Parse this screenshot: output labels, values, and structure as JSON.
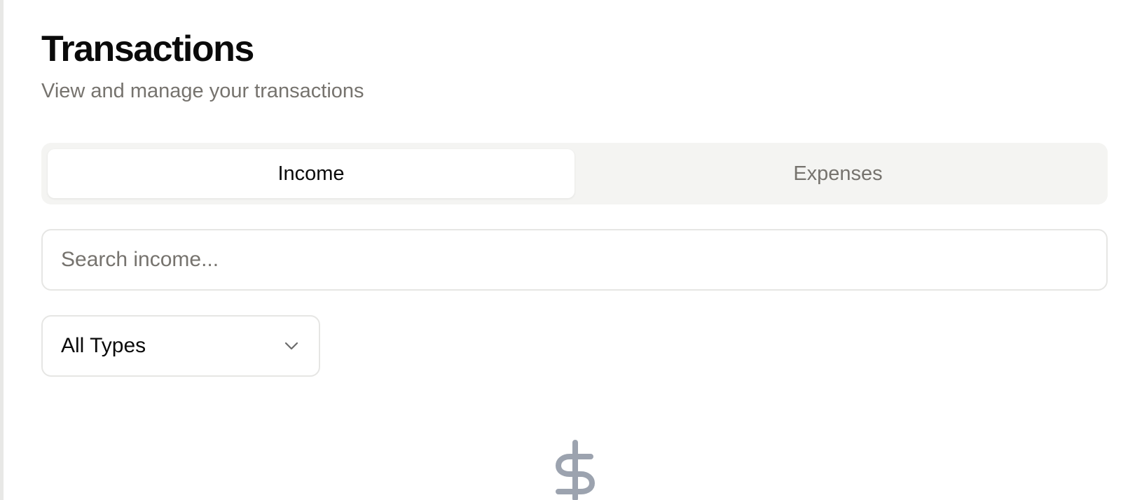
{
  "header": {
    "title": "Transactions",
    "subtitle": "View and manage your transactions"
  },
  "tabs": [
    {
      "label": "Income",
      "active": true
    },
    {
      "label": "Expenses",
      "active": false
    }
  ],
  "search": {
    "placeholder": "Search income...",
    "value": ""
  },
  "filter": {
    "selected": "All Types",
    "icon": "chevron-down-icon"
  },
  "empty_state": {
    "icon": "dollar-sign-icon",
    "icon_color": "#9ca3af"
  },
  "colors": {
    "text_primary": "#0a0a0a",
    "text_muted": "#76736e",
    "tab_bg": "#f4f4f2",
    "border": "#e6e6e4"
  }
}
